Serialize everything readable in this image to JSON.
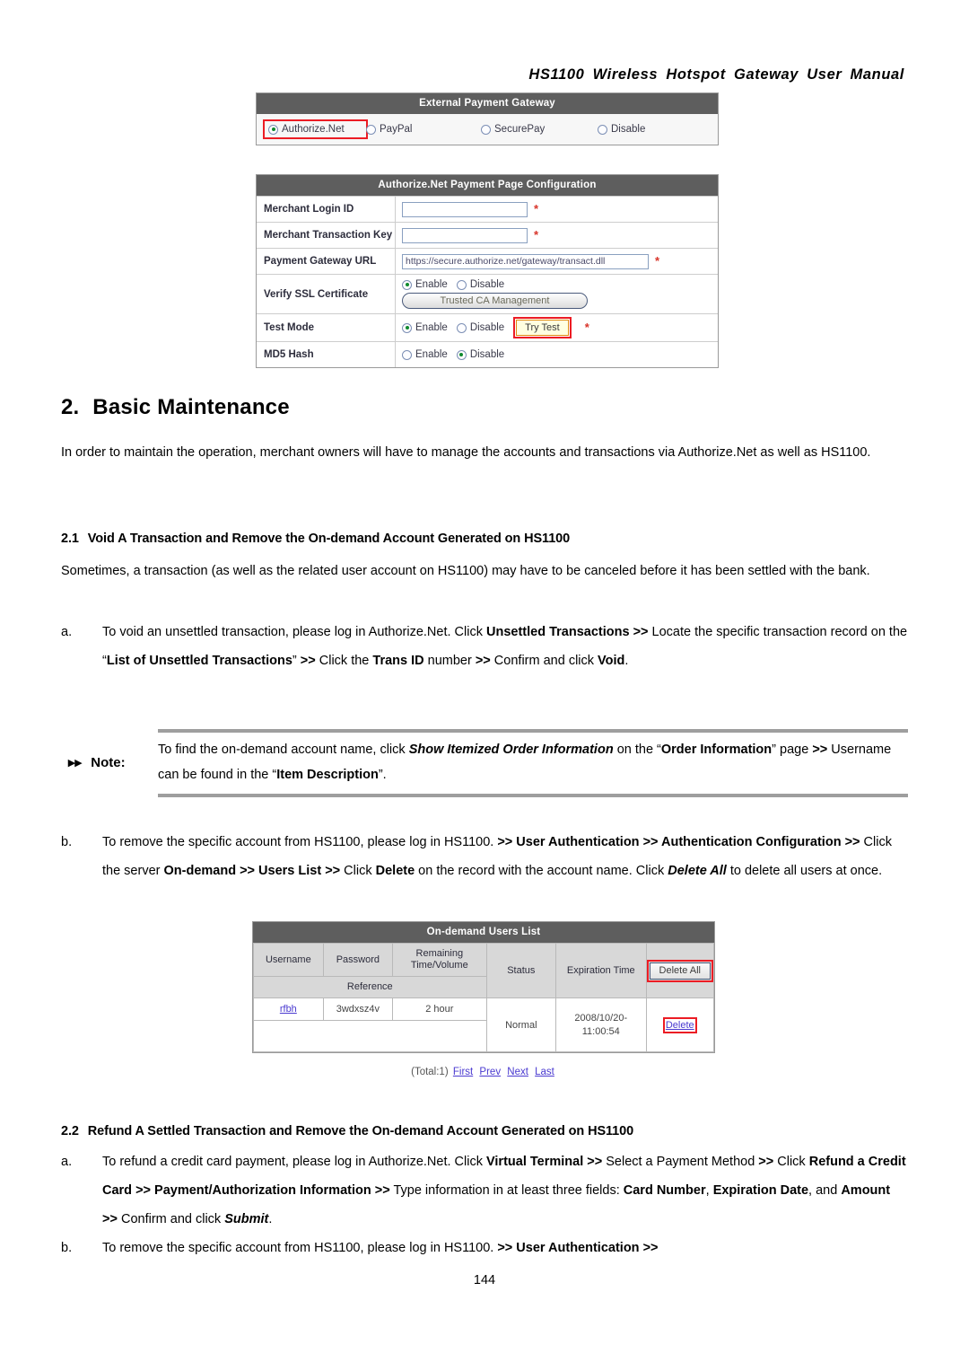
{
  "header": {
    "running_title": "HS1100 Wireless Hotspot Gateway User Manual"
  },
  "gateway_panel": {
    "title": "External Payment Gateway",
    "options": [
      {
        "label": "Authorize.Net",
        "selected": true,
        "highlighted": true
      },
      {
        "label": "PayPal",
        "selected": false,
        "highlighted": false
      },
      {
        "label": "SecurePay",
        "selected": false,
        "highlighted": false
      },
      {
        "label": "Disable",
        "selected": false,
        "highlighted": false
      }
    ]
  },
  "auth_config_panel": {
    "title": "Authorize.Net Payment Page Configuration",
    "rows": {
      "merchant_login_id": {
        "label": "Merchant Login ID",
        "value": "",
        "required_mark": "*"
      },
      "merchant_transaction_key": {
        "label": "Merchant Transaction Key",
        "value": "",
        "required_mark": "*"
      },
      "payment_gateway_url": {
        "label": "Payment Gateway URL",
        "value": "https://secure.authorize.net/gateway/transact.dll",
        "required_mark": "*"
      },
      "verify_ssl": {
        "label": "Verify SSL Certificate",
        "enable_label": "Enable",
        "disable_label": "Disable",
        "selected": "Enable",
        "button_label": "Trusted CA Management"
      },
      "test_mode": {
        "label": "Test Mode",
        "enable_label": "Enable",
        "disable_label": "Disable",
        "selected": "Enable",
        "button_label": "Try Test",
        "required_mark": "*"
      },
      "md5_hash": {
        "label": "MD5 Hash",
        "enable_label": "Enable",
        "disable_label": "Disable",
        "selected": "Disable"
      }
    }
  },
  "content": {
    "h2_number": "2.",
    "h2_title": "Basic Maintenance",
    "intro": "In order to maintain the operation, merchant owners will have to manage the accounts and transactions via Authorize.Net as well as HS1100.",
    "section_2_1": {
      "number": "2.1",
      "title": "Void A Transaction and Remove the On-demand Account Generated on HS1100",
      "lead": "Sometimes, a transaction (as well as the related user account on HS1100) may have to be canceled before it has been settled with the bank.",
      "item_a_mark": "a.",
      "item_b_mark": "b."
    },
    "note": {
      "label": "Note:",
      "bullet": "▸▸"
    },
    "section_2_2": {
      "number": "2.2",
      "title": "Refund A Settled Transaction and Remove the On-demand Account Generated on HS1100",
      "item_a_mark": "a.",
      "item_b_mark": "b."
    }
  },
  "users_panel": {
    "title": "On-demand Users List",
    "headers": {
      "username": "Username",
      "password": "Password",
      "remaining": "Remaining Time/Volume",
      "reference": "Reference",
      "status": "Status",
      "expiration": "Expiration Time",
      "delete_all": "Delete All"
    },
    "rows": [
      {
        "username": "rfbh",
        "password": "3wdxsz4v",
        "remaining": "2 hour",
        "reference": "",
        "status": "Normal",
        "expiration": "2008/10/20-11:00:54",
        "delete": "Delete"
      }
    ],
    "pager": {
      "total": "(Total:1)",
      "first": "First",
      "prev": "Prev",
      "next": "Next",
      "last": "Last"
    }
  },
  "page_number": "144",
  "colors": {
    "panel_title_bg": "#5e5e5e",
    "highlight_red": "#ec1c24",
    "radio_on": "#0f8a2e",
    "link_blue": "#4a3ad0",
    "required_red": "#d8342a",
    "try_test_fill": "#ffffe0",
    "try_test_border": "#e08a12"
  }
}
